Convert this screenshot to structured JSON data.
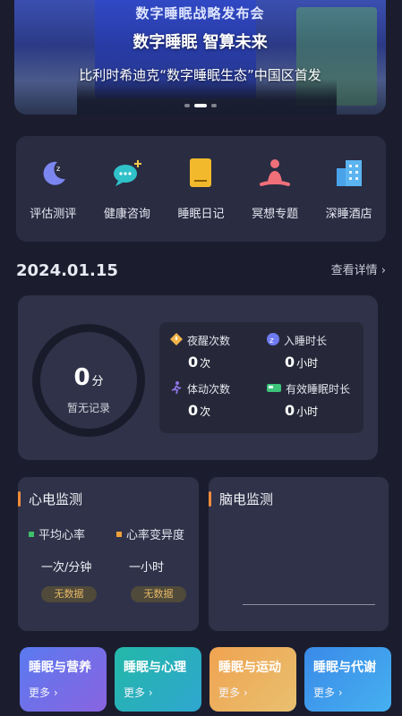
{
  "banner": {
    "poster_text": "数字睡眠战略发布会",
    "headline": "数字睡眠 智算未来",
    "subline": "比利时希迪克“数字睡眠生态”中国区首发"
  },
  "quick_actions": [
    {
      "label": "评估测评",
      "icon": "moon-icon"
    },
    {
      "label": "健康咨询",
      "icon": "chat-icon"
    },
    {
      "label": "睡眠日记",
      "icon": "diary-icon"
    },
    {
      "label": "冥想专题",
      "icon": "meditation-icon"
    },
    {
      "label": "深睡酒店",
      "icon": "hotel-icon"
    }
  ],
  "date": "2024.01.15",
  "detail_link": "查看详情 ›",
  "sleep_summary": {
    "score": "0",
    "score_unit": "分",
    "score_caption": "暂无记录",
    "stats": [
      {
        "label": "夜醒次数",
        "value": "0",
        "unit": "次",
        "icon": "diamond-icon"
      },
      {
        "label": "入睡时长",
        "value": "0",
        "unit": "小时",
        "icon": "sleep-moon-icon"
      },
      {
        "label": "体动次数",
        "value": "0",
        "unit": "次",
        "icon": "running-icon"
      },
      {
        "label": "有效睡眠时长",
        "value": "0",
        "unit": "小时",
        "icon": "bed-icon"
      }
    ]
  },
  "ecg": {
    "title": "心电监测",
    "metrics": [
      {
        "label": "平均心率",
        "value": "一次/分钟",
        "badge": "无数据",
        "color": "#3fbf6a"
      },
      {
        "label": "心率变异度",
        "value": "一小时",
        "badge": "无数据",
        "color": "#f0a23a"
      }
    ]
  },
  "eeg": {
    "title": "脑电监测"
  },
  "tiles": [
    {
      "title": "睡眠与营养",
      "more": "更多 ›"
    },
    {
      "title": "睡眠与心理",
      "more": "更多 ›"
    },
    {
      "title": "睡眠与运动",
      "more": "更多 ›"
    },
    {
      "title": "睡眠与代谢",
      "more": "更多 ›"
    }
  ],
  "colors": {
    "background": "#1b1d2e",
    "card": "#2a2c42",
    "accent_orange": "#f28c3c",
    "badge_text": "#e6b766"
  }
}
